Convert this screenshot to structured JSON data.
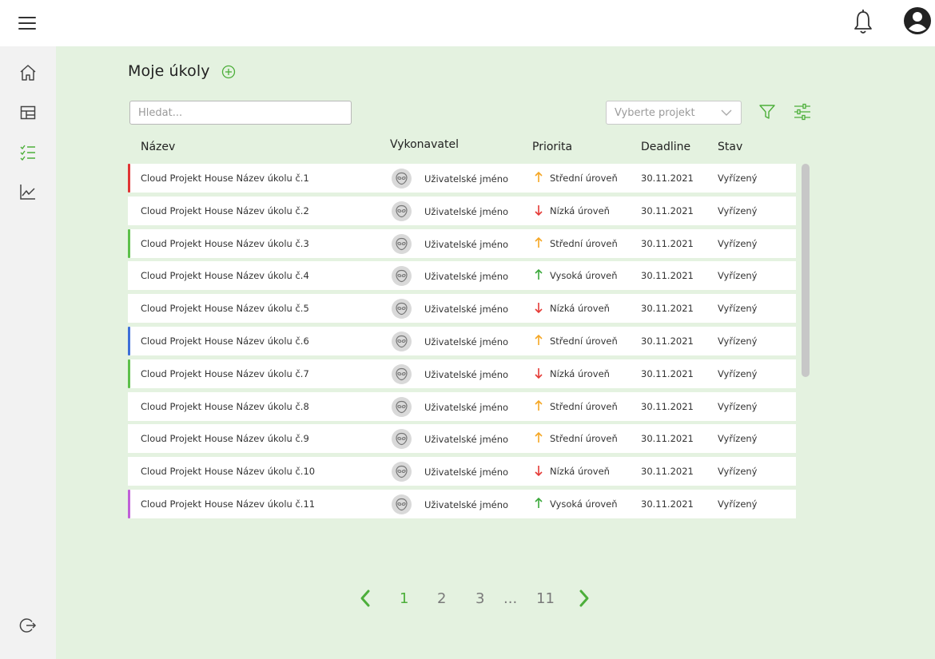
{
  "page": {
    "title": "Moje úkoly"
  },
  "toolbar": {
    "search_placeholder": "Hledat...",
    "project_placeholder": "Vyberte projekt"
  },
  "table": {
    "headers": {
      "name": "Název",
      "assignee": "Vykonavatel",
      "priority": "Priorita",
      "deadline": "Deadline",
      "status": "Stav"
    },
    "rows": [
      {
        "name": "Cloud Projekt House Název úkolu č.1",
        "assignee": "Uživatelské jméno",
        "priority": "Střední úroveň",
        "direction": "up",
        "arrow_color": "#f5a623",
        "deadline": "30.11.2021",
        "status": "Vyřízený",
        "accent": "#e03535"
      },
      {
        "name": "Cloud Projekt House Název úkolu č.2",
        "assignee": "Uživatelské jméno",
        "priority": "Nízká úroveň",
        "direction": "down",
        "arrow_color": "#e53935",
        "deadline": "30.11.2021",
        "status": "Vyřízený",
        "accent": ""
      },
      {
        "name": "Cloud Projekt House Název úkolu č.3",
        "assignee": "Uživatelské jméno",
        "priority": "Střední úroveň",
        "direction": "up",
        "arrow_color": "#f5a623",
        "deadline": "30.11.2021",
        "status": "Vyřízený",
        "accent": "#5cc04a"
      },
      {
        "name": "Cloud Projekt House Název úkolu č.4",
        "assignee": "Uživatelské jméno",
        "priority": "Vysoká úroveň",
        "direction": "up",
        "arrow_color": "#3aa83a",
        "deadline": "30.11.2021",
        "status": "Vyřízený",
        "accent": ""
      },
      {
        "name": "Cloud Projekt House Název úkolu č.5",
        "assignee": "Uživatelské jméno",
        "priority": "Nízká úroveň",
        "direction": "down",
        "arrow_color": "#e53935",
        "deadline": "30.11.2021",
        "status": "Vyřízený",
        "accent": ""
      },
      {
        "name": "Cloud Projekt House Název úkolu č.6",
        "assignee": "Uživatelské jméno",
        "priority": "Střední úroveň",
        "direction": "up",
        "arrow_color": "#f5a623",
        "deadline": "30.11.2021",
        "status": "Vyřízený",
        "accent": "#3d6fd8"
      },
      {
        "name": "Cloud Projekt House Název úkolu č.7",
        "assignee": "Uživatelské jméno",
        "priority": "Nízká úroveň",
        "direction": "down",
        "arrow_color": "#e53935",
        "deadline": "30.11.2021",
        "status": "Vyřízený",
        "accent": "#5cc04a"
      },
      {
        "name": "Cloud Projekt House Název úkolu č.8",
        "assignee": "Uživatelské jméno",
        "priority": "Střední úroveň",
        "direction": "up",
        "arrow_color": "#f5a623",
        "deadline": "30.11.2021",
        "status": "Vyřízený",
        "accent": ""
      },
      {
        "name": "Cloud Projekt House Název úkolu č.9",
        "assignee": "Uživatelské jméno",
        "priority": "Střední úroveň",
        "direction": "up",
        "arrow_color": "#f5a623",
        "deadline": "30.11.2021",
        "status": "Vyřízený",
        "accent": ""
      },
      {
        "name": "Cloud Projekt House Název úkolu č.10",
        "assignee": "Uživatelské jméno",
        "priority": "Nízká úroveň",
        "direction": "down",
        "arrow_color": "#e53935",
        "deadline": "30.11.2021",
        "status": "Vyřízený",
        "accent": ""
      },
      {
        "name": "Cloud Projekt House Název úkolu č.11",
        "assignee": "Uživatelské jméno",
        "priority": "Vysoká úroveň",
        "direction": "up",
        "arrow_color": "#3aa83a",
        "deadline": "30.11.2021",
        "status": "Vyřízený",
        "accent": "#c060d8"
      }
    ]
  },
  "pagination": {
    "pages": [
      "1",
      "2",
      "3"
    ],
    "ellipsis": "...",
    "last": "11",
    "current": "1"
  },
  "colors": {
    "accent_green": "#4caf3a",
    "main_bg": "#e4f2e0",
    "sidebar_bg": "#f2f2f2"
  },
  "icons": {
    "menu": "menu-icon",
    "bell": "bell-icon",
    "profile": "profile-icon",
    "home": "home-icon",
    "dashboard": "dashboard-icon",
    "tasks": "tasks-icon",
    "chart": "chart-icon",
    "logout": "logout-icon",
    "add": "add-icon",
    "filter": "filter-icon",
    "settings": "sliders-icon"
  }
}
